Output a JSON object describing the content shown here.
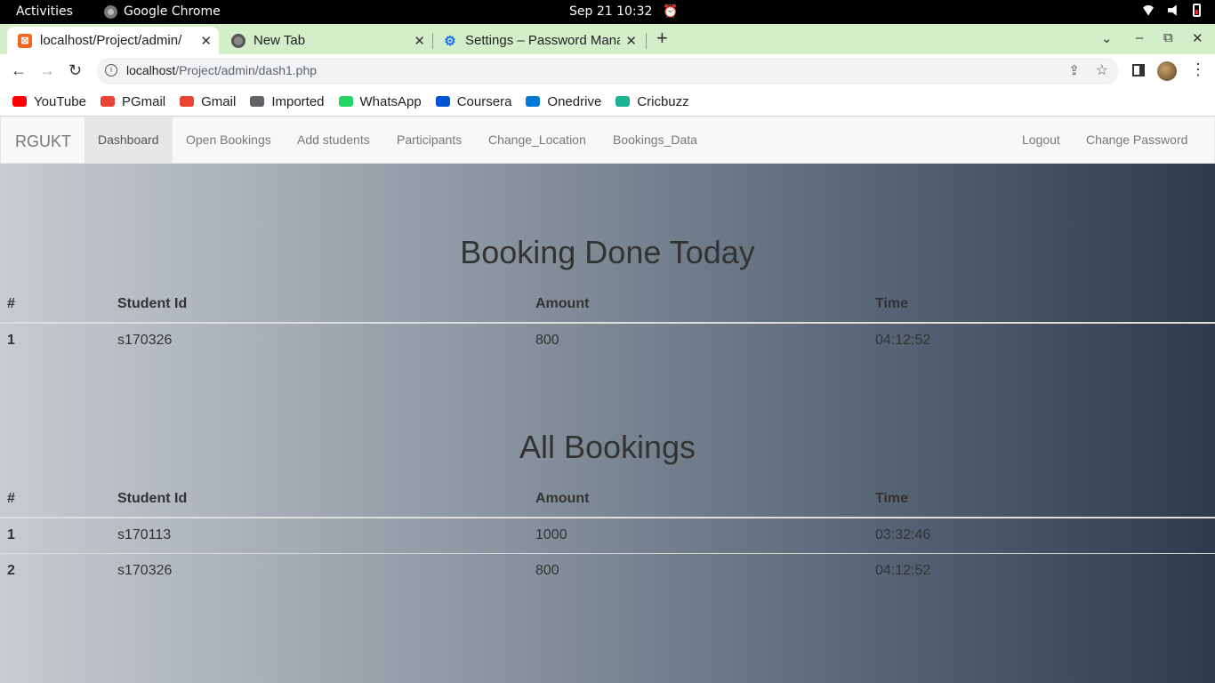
{
  "system": {
    "activities": "Activities",
    "app_name": "Google Chrome",
    "clock": "Sep 21  10:32"
  },
  "tabs": [
    {
      "title": "localhost/Project/admin/",
      "active": true
    },
    {
      "title": "New Tab",
      "active": false
    },
    {
      "title": "Settings – Password Mana",
      "active": false
    }
  ],
  "omnibox": {
    "host": "localhost",
    "path": "/Project/admin/dash1.php"
  },
  "bookmarks": [
    {
      "label": "YouTube",
      "icon": "youtube-icon",
      "color": "#ff0000"
    },
    {
      "label": "PGmail",
      "icon": "gmail-icon",
      "color": "#ea4335"
    },
    {
      "label": "Gmail",
      "icon": "gmail-icon",
      "color": "#ea4335"
    },
    {
      "label": "Imported",
      "icon": "folder-icon",
      "color": "#5f6368"
    },
    {
      "label": "WhatsApp",
      "icon": "whatsapp-icon",
      "color": "#25d366"
    },
    {
      "label": "Coursera",
      "icon": "coursera-icon",
      "color": "#0056d2"
    },
    {
      "label": "Onedrive",
      "icon": "onedrive-icon",
      "color": "#0078d4"
    },
    {
      "label": "Cricbuzz",
      "icon": "cricbuzz-icon",
      "color": "#1ab394"
    }
  ],
  "navbar": {
    "brand": "RGUKT",
    "items": [
      "Dashboard",
      "Open Bookings",
      "Add students",
      "Participants",
      "Change_Location",
      "Bookings_Data"
    ],
    "right_items": [
      "Logout",
      "Change Password"
    ]
  },
  "today": {
    "title": "Booking Done Today",
    "headers": [
      "#",
      "Student Id",
      "Amount",
      "Time"
    ],
    "rows": [
      [
        "1",
        "s170326",
        "800",
        "04:12:52"
      ]
    ]
  },
  "all": {
    "title": "All Bookings",
    "headers": [
      "#",
      "Student Id",
      "Amount",
      "Time"
    ],
    "rows": [
      [
        "1",
        "s170113",
        "1000",
        "03:32:46"
      ],
      [
        "2",
        "s170326",
        "800",
        "04:12:52"
      ]
    ]
  }
}
